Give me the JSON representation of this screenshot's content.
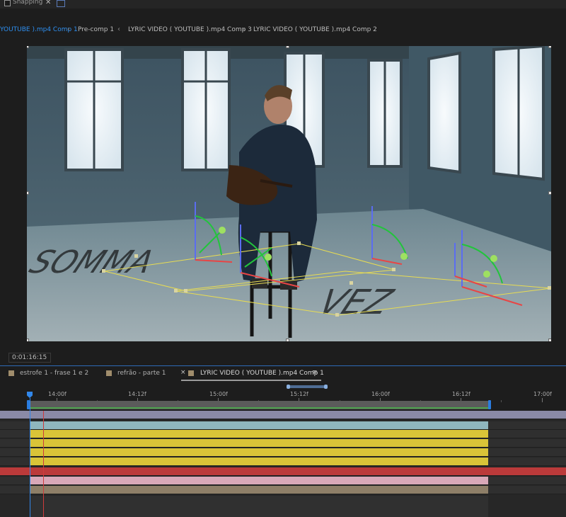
{
  "toolbar": {
    "snapping_label": "Snapping"
  },
  "comp_tabs": [
    {
      "label": "YOUTUBE ).mp4 Comp 1",
      "active": true
    },
    {
      "label": "Pre-comp 1",
      "active": false
    },
    {
      "label": "LYRIC VIDEO ( YOUTUBE ).mp4 Comp 3",
      "active": false
    },
    {
      "label": "LYRIC VIDEO ( YOUTUBE ).mp4 Comp 2",
      "active": false
    }
  ],
  "viewer": {
    "floor_text_line1": "SOMMA",
    "floor_text_line2": "VEZ"
  },
  "timecode": "0:01:16:15",
  "timeline_tabs": [
    {
      "label": "estrofe 1 - frase 1 e 2",
      "active": false
    },
    {
      "label": "refrão - parte 1",
      "active": false
    },
    {
      "label": "LYRIC VIDEO ( YOUTUBE ).mp4 Comp 1",
      "active": true
    }
  ],
  "ruler": {
    "labels": [
      "14:00f",
      "14:12f",
      "15:00f",
      "15:12f",
      "16:00f",
      "16:12f",
      "17:00f"
    ]
  },
  "tracks": [
    {
      "color": "#8a8aa6"
    },
    {
      "color": "#8fb6be"
    },
    {
      "color": "#d9c438"
    },
    {
      "color": "#d9c438"
    },
    {
      "color": "#d9c438"
    },
    {
      "color": "#d9c438"
    },
    {
      "color": "#bb3a3a"
    },
    {
      "color": "#d9a8b8"
    },
    {
      "color": "#8e7f68"
    }
  ],
  "colors": {
    "accent": "#2e8ff0",
    "work_area": "#4ea14e",
    "playhead": "#3187ea"
  }
}
